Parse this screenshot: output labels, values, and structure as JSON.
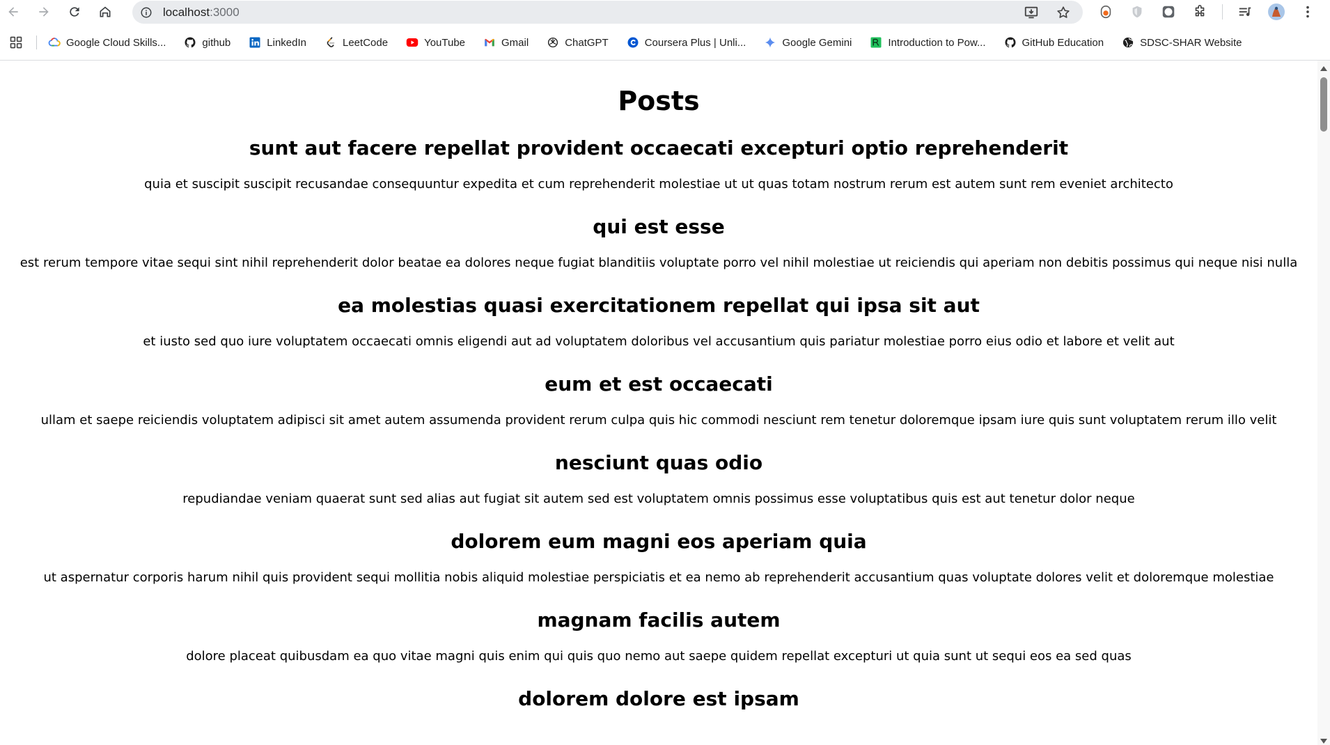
{
  "browser": {
    "url_host": "localhost",
    "url_port": ":3000"
  },
  "bookmarks": [
    {
      "label": "Google Cloud Skills...",
      "icon": "google-cloud-icon"
    },
    {
      "label": "github",
      "icon": "github-icon"
    },
    {
      "label": "LinkedIn",
      "icon": "linkedin-icon"
    },
    {
      "label": "LeetCode",
      "icon": "leetcode-icon"
    },
    {
      "label": "YouTube",
      "icon": "youtube-icon"
    },
    {
      "label": "Gmail",
      "icon": "gmail-icon"
    },
    {
      "label": "ChatGPT",
      "icon": "chatgpt-icon"
    },
    {
      "label": "Coursera Plus | Unli...",
      "icon": "coursera-icon"
    },
    {
      "label": "Google Gemini",
      "icon": "gemini-icon"
    },
    {
      "label": "Introduction to Pow...",
      "icon": "powerbi-icon"
    },
    {
      "label": "GitHub Education",
      "icon": "github-icon"
    },
    {
      "label": "SDSC-SHAR Website",
      "icon": "globe-icon"
    }
  ],
  "page": {
    "title": "Posts",
    "posts": [
      {
        "title": "sunt aut facere repellat provident occaecati excepturi optio reprehenderit",
        "body": "quia et suscipit suscipit recusandae consequuntur expedita et cum reprehenderit molestiae ut ut quas totam nostrum rerum est autem sunt rem eveniet architecto"
      },
      {
        "title": "qui est esse",
        "body": "est rerum tempore vitae sequi sint nihil reprehenderit dolor beatae ea dolores neque fugiat blanditiis voluptate porro vel nihil molestiae ut reiciendis qui aperiam non debitis possimus qui neque nisi nulla"
      },
      {
        "title": "ea molestias quasi exercitationem repellat qui ipsa sit aut",
        "body": "et iusto sed quo iure voluptatem occaecati omnis eligendi aut ad voluptatem doloribus vel accusantium quis pariatur molestiae porro eius odio et labore et velit aut"
      },
      {
        "title": "eum et est occaecati",
        "body": "ullam et saepe reiciendis voluptatem adipisci sit amet autem assumenda provident rerum culpa quis hic commodi nesciunt rem tenetur doloremque ipsam iure quis sunt voluptatem rerum illo velit"
      },
      {
        "title": "nesciunt quas odio",
        "body": "repudiandae veniam quaerat sunt sed alias aut fugiat sit autem sed est voluptatem omnis possimus esse voluptatibus quis est aut tenetur dolor neque"
      },
      {
        "title": "dolorem eum magni eos aperiam quia",
        "body": "ut aspernatur corporis harum nihil quis provident sequi mollitia nobis aliquid molestiae perspiciatis et ea nemo ab reprehenderit accusantium quas voluptate dolores velit et doloremque molestiae"
      },
      {
        "title": "magnam facilis autem",
        "body": "dolore placeat quibusdam ea quo vitae magni quis enim qui quis quo nemo aut saepe quidem repellat excepturi ut quia sunt ut sequi eos ea sed quas"
      },
      {
        "title": "dolorem dolore est ipsam",
        "body": ""
      }
    ]
  }
}
